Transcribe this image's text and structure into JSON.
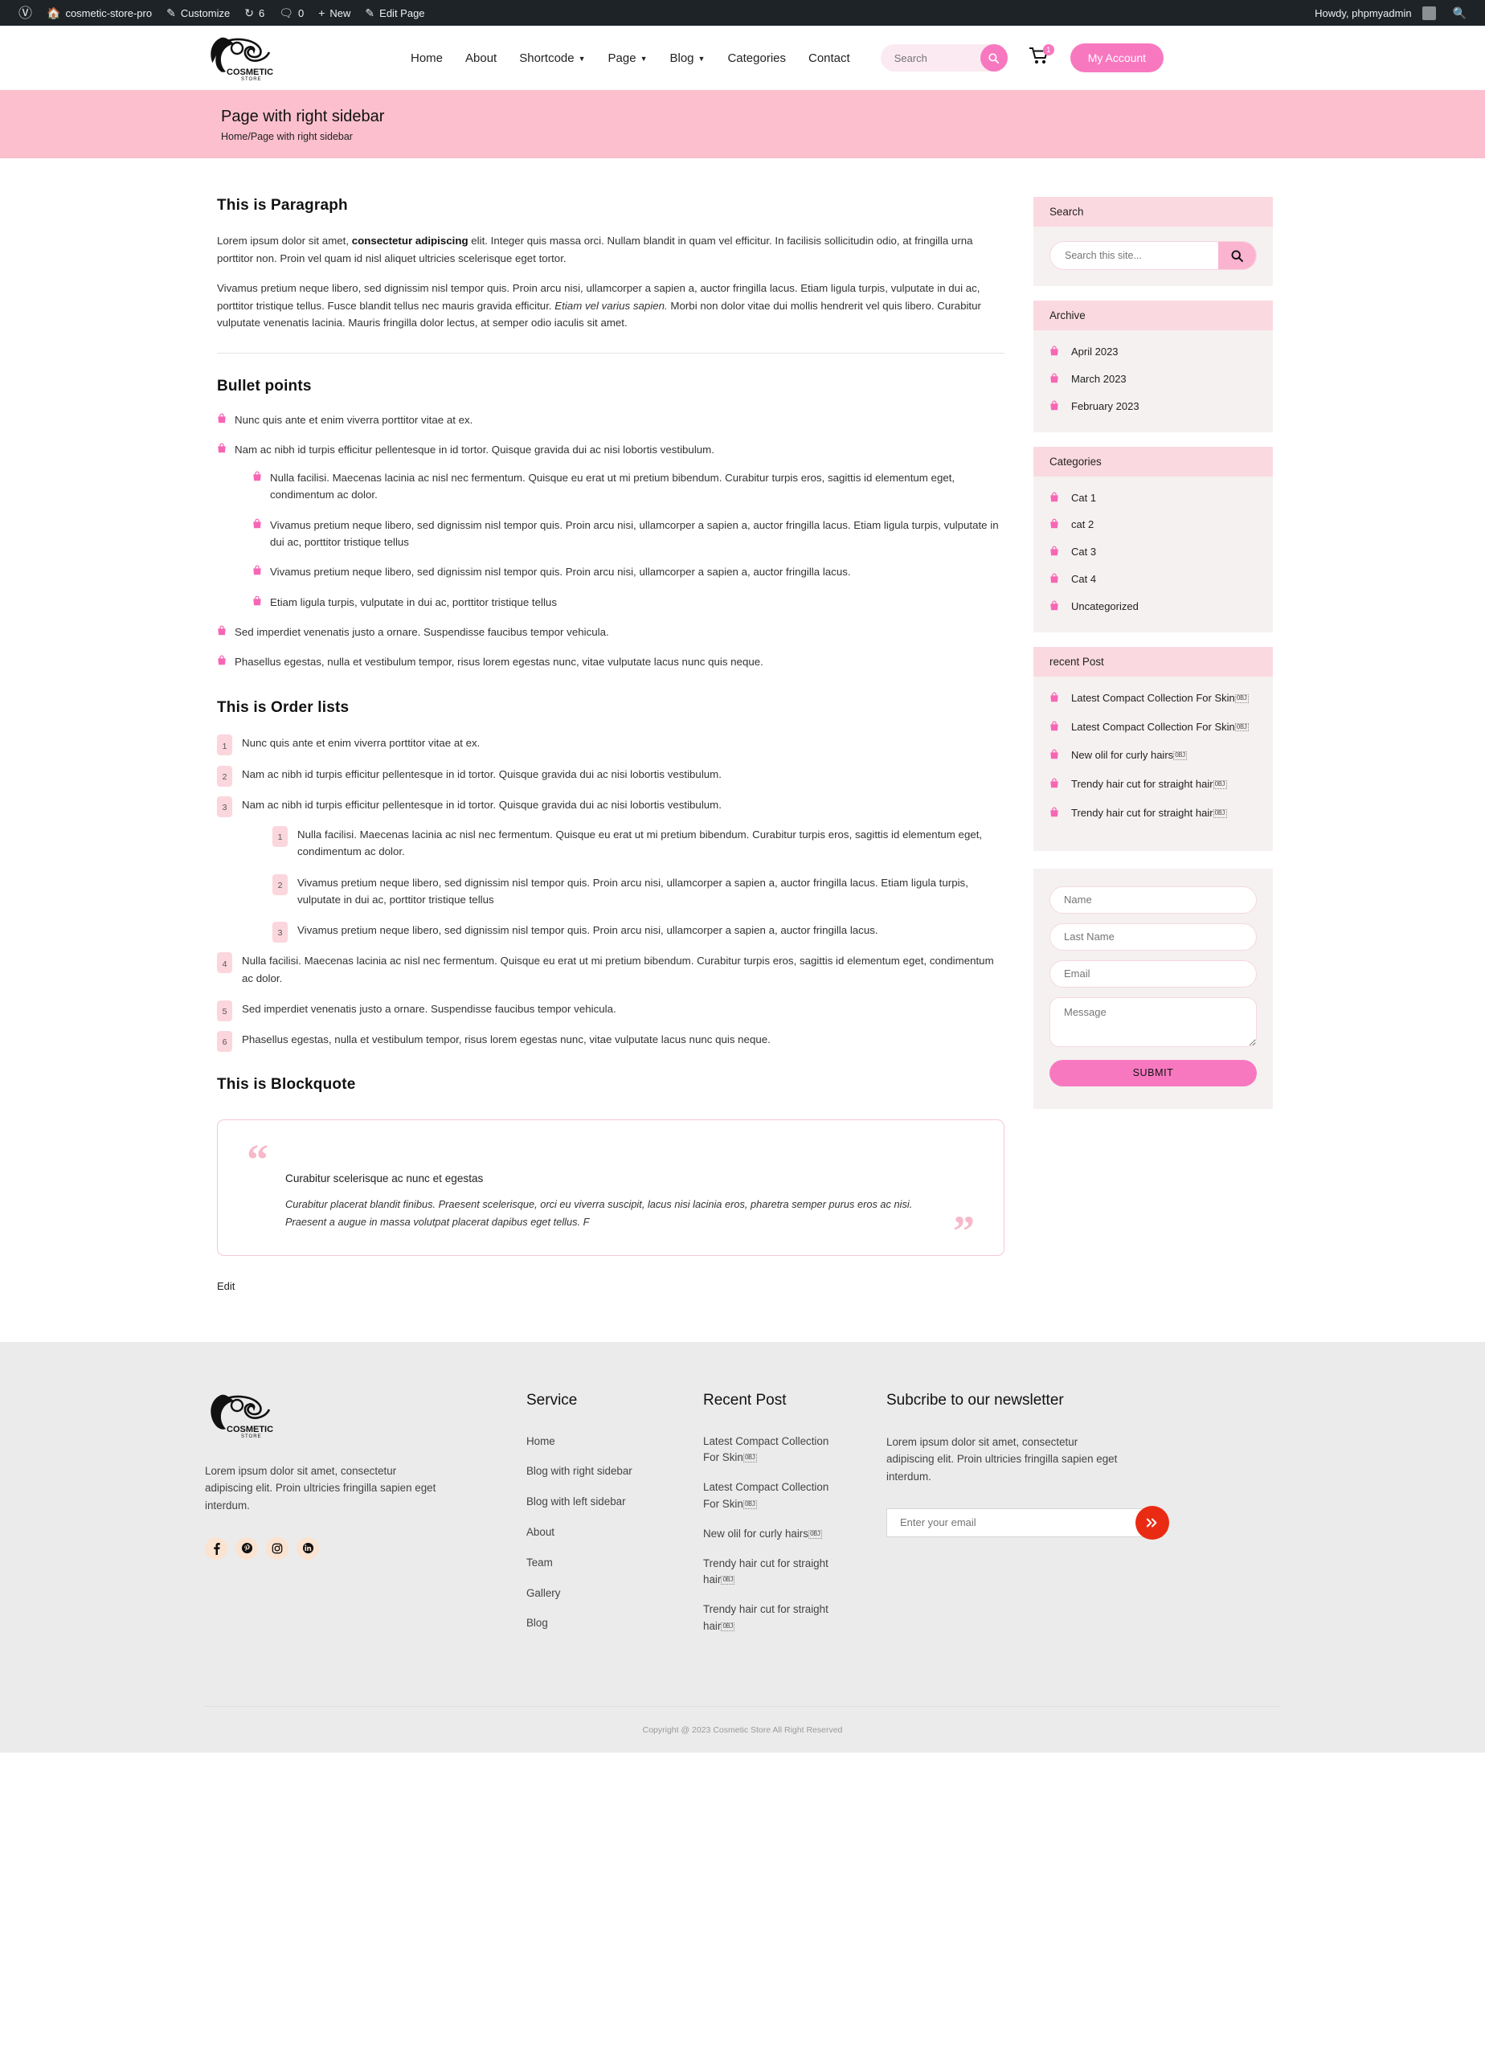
{
  "adminbar": {
    "site_name": "cosmetic-store-pro",
    "customize": "Customize",
    "comments_count": "6",
    "updates_count": "0",
    "new": "New",
    "edit_page": "Edit Page",
    "howdy": "Howdy, phpmyadmin"
  },
  "header": {
    "logo_text": "COSMETIC",
    "logo_sub": "STORE",
    "nav": [
      {
        "label": "Home",
        "caret": false
      },
      {
        "label": "About",
        "caret": false
      },
      {
        "label": "Shortcode",
        "caret": true
      },
      {
        "label": "Page",
        "caret": true
      },
      {
        "label": "Blog",
        "caret": true
      },
      {
        "label": "Categories",
        "caret": false
      },
      {
        "label": "Contact",
        "caret": false
      }
    ],
    "search_placeholder": "Search",
    "cart_count": "1",
    "account_button": "My Account"
  },
  "banner": {
    "title": "Page with right sidebar",
    "breadcrumb": "Home/Page with right sidebar"
  },
  "content": {
    "paragraph_heading": "This is Paragraph",
    "p1_a": "Lorem ipsum dolor sit amet, ",
    "p1_b": "consectetur adipiscing",
    "p1_c": " elit. Integer quis massa orci. Nullam blandit in quam vel efficitur. In facilisis sollicitudin odio, at fringilla urna porttitor non. Proin vel quam id nisl aliquet ultricies scelerisque eget tortor.",
    "p2_a": "Vivamus pretium neque libero, sed dignissim nisl tempor quis. Proin arcu nisi, ullamcorper a sapien a, auctor fringilla lacus. Etiam ligula turpis, vulputate in dui ac, porttitor tristique tellus. Fusce blandit tellus nec mauris gravida efficitur. ",
    "p2_i": "Etiam vel varius sapien.",
    "p2_c": " Morbi non dolor vitae dui mollis hendrerit vel quis libero. Curabitur vulputate venenatis lacinia. Mauris fringilla dolor lectus, at semper odio iaculis sit amet.",
    "bullet_heading": "Bullet points",
    "bullets": [
      "Nunc quis ante et enim viverra porttitor vitae at ex.",
      "Nam ac nibh id turpis efficitur pellentesque in id tortor. Quisque gravida dui ac nisi lobortis vestibulum.",
      "Sed imperdiet venenatis justo a ornare. Suspendisse faucibus tempor vehicula.",
      "Phasellus egestas, nulla et vestibulum tempor, risus lorem egestas nunc, vitae vulputate lacus nunc quis neque."
    ],
    "bullets_nested": [
      "Nulla facilisi. Maecenas lacinia ac nisl nec fermentum. Quisque eu erat ut mi pretium bibendum. Curabitur turpis eros, sagittis id elementum eget, condimentum ac dolor.",
      "Vivamus pretium neque libero, sed dignissim nisl tempor quis. Proin arcu nisi, ullamcorper a sapien a, auctor fringilla lacus. Etiam ligula turpis, vulputate in dui ac, porttitor tristique tellus",
      "Vivamus pretium neque libero, sed dignissim nisl tempor quis. Proin arcu nisi, ullamcorper a sapien a, auctor fringilla lacus.",
      "Etiam ligula turpis, vulputate in dui ac, porttitor tristique tellus"
    ],
    "order_heading": "This is Order lists",
    "ordered": [
      "Nunc quis ante et enim viverra porttitor vitae at ex.",
      "Nam ac nibh id turpis efficitur pellentesque in id tortor. Quisque gravida dui ac nisi lobortis vestibulum.",
      "Nam ac nibh id turpis efficitur pellentesque in id tortor. Quisque gravida dui ac nisi lobortis vestibulum.",
      "Nulla facilisi. Maecenas lacinia ac nisl nec fermentum. Quisque eu erat ut mi pretium bibendum. Curabitur turpis eros, sagittis id elementum eget, condimentum ac dolor.",
      "Sed imperdiet venenatis justo a ornare. Suspendisse faucibus tempor vehicula.",
      "Phasellus egestas, nulla et vestibulum tempor, risus lorem egestas nunc, vitae vulputate lacus nunc quis neque."
    ],
    "ordered_nested": [
      "Nulla facilisi. Maecenas lacinia ac nisl nec fermentum. Quisque eu erat ut mi pretium bibendum. Curabitur turpis eros, sagittis id elementum eget, condimentum ac dolor.",
      "Vivamus pretium neque libero, sed dignissim nisl tempor quis. Proin arcu nisi, ullamcorper a sapien a, auctor fringilla lacus. Etiam ligula turpis, vulputate in dui ac, porttitor tristique tellus",
      "Vivamus pretium neque libero, sed dignissim nisl tempor quis. Proin arcu nisi, ullamcorper a sapien a, auctor fringilla lacus."
    ],
    "blockquote_heading": "This is Blockquote",
    "blockquote_title": "Curabitur scelerisque ac nunc et egestas",
    "blockquote_text": "Curabitur placerat blandit finibus. Praesent scelerisque, orci eu viverra suscipit, lacus nisi lacinia eros, pharetra semper purus eros ac nisi. Praesent a augue in massa volutpat placerat dapibus eget tellus. F",
    "edit_link": "Edit"
  },
  "sidebar": {
    "search_title": "Search",
    "search_placeholder": "Search this site...",
    "archive_title": "Archive",
    "archive_items": [
      "April 2023",
      "March 2023",
      "February 2023"
    ],
    "categories_title": "Categories",
    "categories_items": [
      "Cat 1",
      "cat 2",
      "Cat 3",
      "Cat 4",
      "Uncategorized"
    ],
    "recent_title": "recent Post",
    "recent_items": [
      "Latest Compact Collection For Skin",
      "Latest Compact Collection For Skin",
      "New olil for curly hairs",
      "Trendy hair cut for straight hair",
      "Trendy hair cut for straight hair"
    ],
    "obj_glyph": "OBJ",
    "form": {
      "name_placeholder": "Name",
      "lastname_placeholder": "Last Name",
      "email_placeholder": "Email",
      "message_placeholder": "Message",
      "submit_label": "SUBMIT"
    }
  },
  "footer": {
    "logo_text": "COSMETIC",
    "logo_sub": "STORE",
    "about": "Lorem ipsum dolor sit amet, consectetur adipiscing elit. Proin ultricies fringilla sapien eget interdum.",
    "socials": [
      "facebook-icon",
      "pinterest-icon",
      "instagram-icon",
      "linkedin-icon"
    ],
    "service_title": "Service",
    "service_items": [
      "Home",
      "Blog with right sidebar",
      "Blog with left sidebar",
      "About",
      "Team",
      "Gallery",
      "Blog"
    ],
    "recent_title": "Recent Post",
    "recent_items": [
      "Latest Compact Collection For Skin",
      "Latest Compact Collection For Skin",
      "New olil for curly hairs",
      "Trendy hair cut for straight hair",
      "Trendy hair cut for straight hair"
    ],
    "obj_glyph": "OBJ",
    "newsletter_title": "Subcribe to our newsletter",
    "newsletter_text": "Lorem ipsum dolor sit amet, consectetur adipiscing elit. Proin ultricies fringilla sapien eget interdum.",
    "newsletter_placeholder": "Enter your email",
    "copyright": "Copyright @ 2023 Cosmetic Store All Right Reserved"
  },
  "colors": {
    "accent_pink": "#f878c0",
    "banner_pink": "#fbbfce",
    "widget_head": "#fbd9e1",
    "widget_body": "#f5f1f0",
    "footer_bg": "#ebebeb",
    "newsletter_btn": "#ea2b13"
  }
}
